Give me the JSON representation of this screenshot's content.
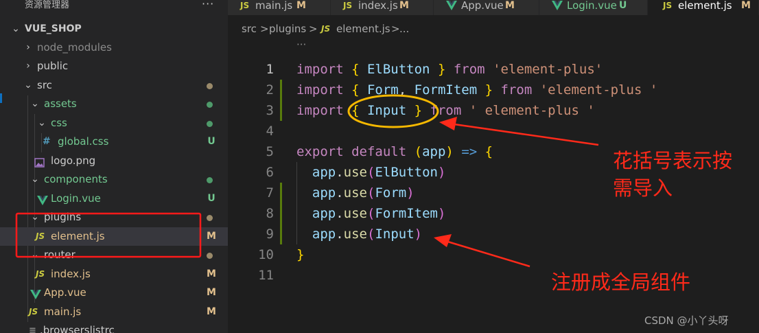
{
  "explorer": {
    "title": "资源管理器",
    "more": "···",
    "root": "VUE_SHOP",
    "items": [
      {
        "label": "node_modules",
        "status": ""
      },
      {
        "label": "public",
        "status": ""
      },
      {
        "label": "src",
        "status": ""
      },
      {
        "label": "assets",
        "status": ""
      },
      {
        "label": "css",
        "status": ""
      },
      {
        "label": "global.css",
        "icon": "#",
        "status": "U"
      },
      {
        "label": "logo.png",
        "status": ""
      },
      {
        "label": "components",
        "status": ""
      },
      {
        "label": "Login.vue",
        "status": "U"
      },
      {
        "label": "plugins",
        "status": ""
      },
      {
        "label": "element.js",
        "icon": "JS",
        "status": "M"
      },
      {
        "label": "router",
        "status": ""
      },
      {
        "label": "index.js",
        "icon": "JS",
        "status": "M"
      },
      {
        "label": "App.vue",
        "status": "M"
      },
      {
        "label": "main.js",
        "icon": "JS",
        "status": "M"
      },
      {
        "label": ".browserslistrc",
        "status": ""
      }
    ]
  },
  "tabs": [
    {
      "label": "main.js",
      "icon": "JS",
      "status": "M"
    },
    {
      "label": "index.js",
      "icon": "JS",
      "status": "M"
    },
    {
      "label": "App.vue",
      "status": "M"
    },
    {
      "label": "Login.vue",
      "status": "U"
    },
    {
      "label": "element.js",
      "icon": "JS",
      "status": "M"
    }
  ],
  "breadcrumb": {
    "parts": [
      "src",
      ">",
      "plugins",
      ">",
      "JS",
      "element.js",
      ">",
      "..."
    ],
    "sticky": "···"
  },
  "editor": {
    "line_numbers": [
      "1",
      "2",
      "3",
      "4",
      "5",
      "6",
      "7",
      "8",
      "9",
      "10",
      "11"
    ],
    "lines": [
      [
        "import",
        " ",
        "{",
        " ElButton ",
        "}",
        " ",
        "from",
        " ",
        "'element-plus'"
      ],
      [
        "import",
        " ",
        "{",
        " Form",
        ", ",
        "FormItem ",
        "}",
        " ",
        "from",
        " ",
        "'element-plus '"
      ],
      [
        "import",
        " ",
        "{",
        " Input ",
        "}",
        " ",
        "from",
        " ",
        "' element-plus '"
      ],
      [],
      [
        "export",
        " ",
        "default",
        " ",
        "(",
        "app",
        ")",
        " ",
        "=>",
        " ",
        "{"
      ],
      [
        "  ",
        "app",
        ".",
        "use",
        "(",
        "ElButton",
        ")"
      ],
      [
        "  ",
        "app",
        ".",
        "use",
        "(",
        "Form",
        ")"
      ],
      [
        "  ",
        "app",
        ".",
        "use",
        "(",
        "FormItem",
        ")"
      ],
      [
        "  ",
        "app",
        ".",
        "use",
        "(",
        "Input",
        ")"
      ],
      [
        "}"
      ],
      []
    ]
  },
  "annotations": {
    "note1_line1": "花括号表示按",
    "note1_line2": "需导入",
    "note2": "注册成全局组件"
  },
  "watermark": "CSDN @小丫头呀",
  "colors": {
    "annotation": "#ff2a1a",
    "highlight_circle": "#f5b800",
    "modified": "#e2c08d",
    "untracked": "#73c991",
    "keyword": "#c586c0",
    "string": "#ce9178"
  }
}
